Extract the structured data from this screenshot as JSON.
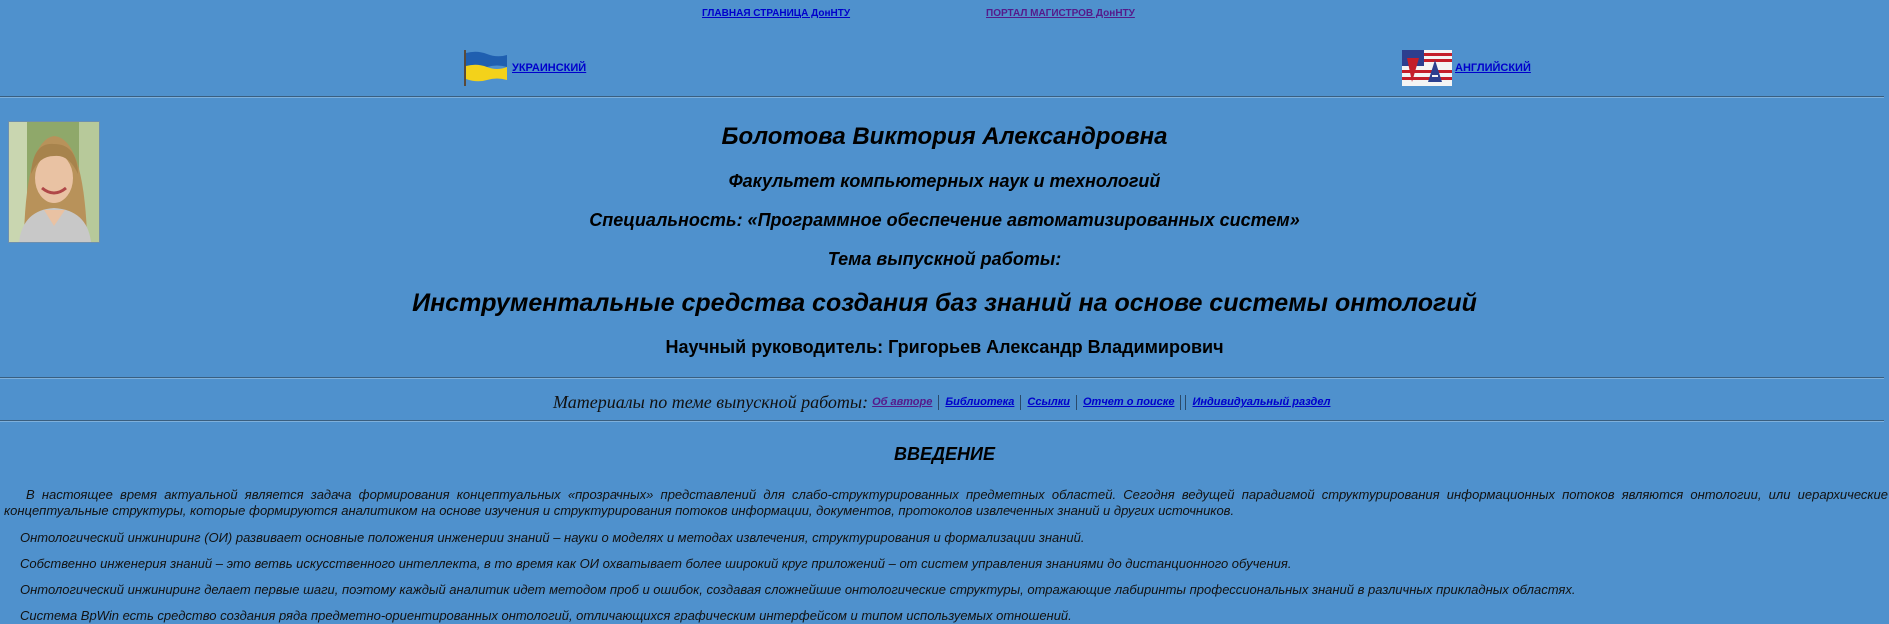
{
  "nav": {
    "main_link": "ГЛАВНАЯ СТРАНИЦА ДонНТУ",
    "portal_link": "ПОРТАЛ МАГИСТРОВ ДонНТУ"
  },
  "languages": {
    "ukrainian": "УКРАИНСКИЙ",
    "english": "АНГЛИЙСКИЙ"
  },
  "profile": {
    "name": "Болотова Виктория Александровна",
    "faculty": "Факультет компьютерных наук и технологий",
    "speciality": "Специальность: «Программное обеспечение автоматизированных систем»",
    "theme_label": "Тема выпускной работы:",
    "theme_title": "Инструментальные средства создания баз знаний на основе системы онтологий",
    "supervisor": "Научный руководитель: Григорьев Александр Владимирович"
  },
  "materials": {
    "label": "Материалы по теме выпускной работы:",
    "links": [
      "Об авторе",
      "Библиотека",
      "Ссылки",
      "Отчет о поиске",
      "Индивидуальный раздел"
    ]
  },
  "intro": {
    "title": "ВВЕДЕНИЕ",
    "paragraphs": [
      "В настоящее время актуальной является задача формирования концептуальных «прозрачных» представлений для слабо-структурированных предметных областей. Сегодня ведущей парадигмой структурирования информационных потоков являются онтологии, или иерархические концептуальные структуры, которые формируются аналитиком на основе изучения и структурирования потоков информации, документов, протоколов извлеченных знаний и других источников.",
      "Онтологический инжиниринг (ОИ) развивает основные положения инженерии знаний – науки о моделях и методах извлечения, структурирования и формализации знаний.",
      "Собственно инженерия знаний – это ветвь искусственного интеллекта, в то время как ОИ охватывает более широкий круг приложений – от систем управления знаниями до дистанционного обучения.",
      "Онтологический инжиниринг делает первые шаги, поэтому каждый аналитик идет методом проб и ошибок, создавая сложнейшие онтологические структуры, отражающие лабиринты профессиональных знаний в различных прикладных областях.",
      "Система BpWin есть средство создания ряда предметно-ориентированных онтологий, отличающихся графическим интерфейсом и типом используемых отношений."
    ]
  },
  "icons": {
    "ua_flag": "ukraine-flag-icon",
    "us_flag": "usa-flag-icon",
    "photo": "author-photo"
  },
  "colors": {
    "background": "#4f91cd",
    "link": "#0000cc",
    "visited_link": "#551a8b"
  }
}
